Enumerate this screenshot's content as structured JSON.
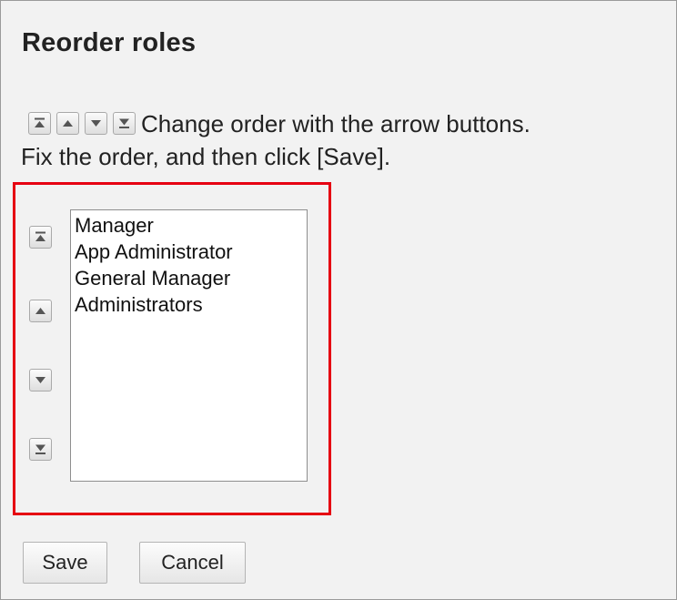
{
  "dialog": {
    "title": "Reorder roles",
    "instruction_line1": "Change order with the arrow buttons.",
    "instruction_line2": "Fix the order, and then click [Save]."
  },
  "order_controls": {
    "icons": [
      "move-to-top-icon",
      "move-up-icon",
      "move-down-icon",
      "move-to-bottom-icon"
    ]
  },
  "roles_list": {
    "items": [
      "Manager",
      "App Administrator",
      "General Manager",
      "Administrators"
    ]
  },
  "buttons": {
    "save_label": "Save",
    "cancel_label": "Cancel"
  },
  "colors": {
    "highlight": "#e60012",
    "background": "#f2f2f2"
  }
}
